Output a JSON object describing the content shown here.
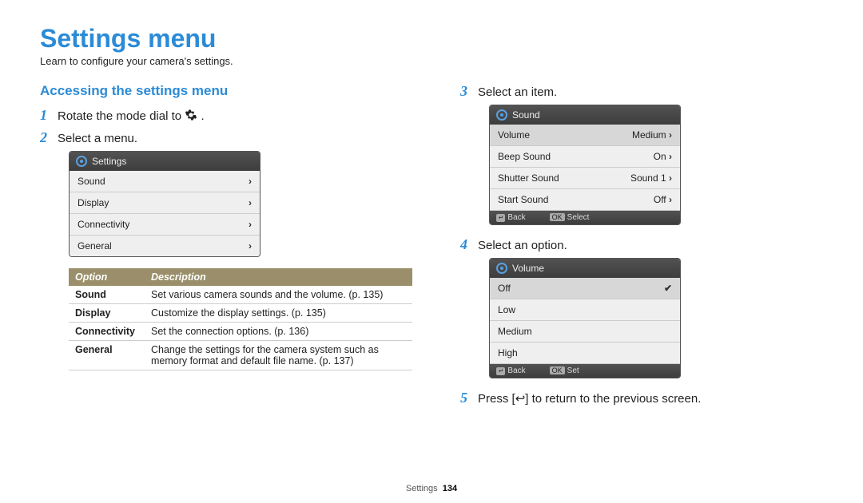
{
  "title": "Settings menu",
  "subtitle": "Learn to configure your camera's settings.",
  "section_heading": "Accessing the settings menu",
  "steps": {
    "1": {
      "pre": "Rotate the mode dial to ",
      "post": "."
    },
    "2": "Select a menu.",
    "3": "Select an item.",
    "4": "Select an option.",
    "5": {
      "pre": "Press [",
      "post": "] to return to the previous screen."
    }
  },
  "screen1": {
    "header": "Settings",
    "rows": [
      "Sound",
      "Display",
      "Connectivity",
      "General"
    ]
  },
  "screen2": {
    "header": "Sound",
    "rows": [
      {
        "label": "Volume",
        "value": "Medium",
        "highlight": true
      },
      {
        "label": "Beep Sound",
        "value": "On"
      },
      {
        "label": "Shutter Sound",
        "value": "Sound 1"
      },
      {
        "label": "Start Sound",
        "value": "Off"
      }
    ],
    "footer": {
      "back": "Back",
      "action": "Select"
    }
  },
  "screen3": {
    "header": "Volume",
    "rows": [
      {
        "label": "Off",
        "checked": true
      },
      {
        "label": "Low"
      },
      {
        "label": "Medium"
      },
      {
        "label": "High"
      }
    ],
    "footer": {
      "back": "Back",
      "action": "Set"
    }
  },
  "opt_table": {
    "headers": [
      "Option",
      "Description"
    ],
    "rows": [
      {
        "name": "Sound",
        "desc": "Set various camera sounds and the volume. (p. 135)"
      },
      {
        "name": "Display",
        "desc": "Customize the display settings. (p. 135)"
      },
      {
        "name": "Connectivity",
        "desc": "Set the connection options. (p. 136)"
      },
      {
        "name": "General",
        "desc": "Change the settings for the camera system such as memory format and default file name. (p. 137)"
      }
    ]
  },
  "footer": {
    "section": "Settings",
    "page": "134"
  },
  "glyphs": {
    "ok": "OK",
    "return": "↩"
  }
}
